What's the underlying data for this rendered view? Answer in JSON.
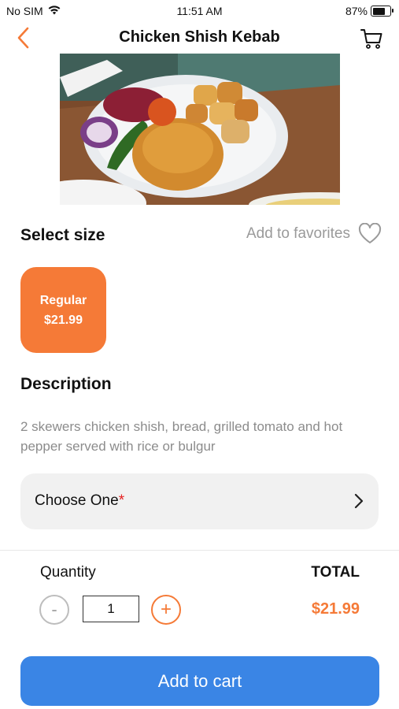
{
  "status_bar": {
    "carrier": "No SIM",
    "time": "11:51 AM",
    "battery": "87%",
    "battery_level": 0.87
  },
  "header": {
    "title": "Chicken Shish Kebab",
    "back_icon": "chevron-left-icon",
    "cart_icon": "cart-icon"
  },
  "hero_image": {
    "alt": "Chicken shish kebab plate with bulgur, peppers, onion and beetroot"
  },
  "size": {
    "title": "Select size",
    "favorites_label": "Add to favorites",
    "options": [
      {
        "name": "Regular",
        "price": "$21.99",
        "selected": true
      }
    ]
  },
  "description": {
    "title": "Description",
    "text": "2 skewers chicken shish, bread, grilled tomato and hot pepper served with rice or bulgur"
  },
  "choose": {
    "label": "Choose One",
    "required_mark": "*"
  },
  "quantity": {
    "label": "Quantity",
    "value": "1",
    "minus": "-",
    "plus": "+"
  },
  "total": {
    "label": "TOTAL",
    "value": "$21.99"
  },
  "cta": {
    "label": "Add to cart"
  },
  "colors": {
    "accent": "#f57a37",
    "primary": "#3a85e5",
    "required": "#e52020"
  }
}
